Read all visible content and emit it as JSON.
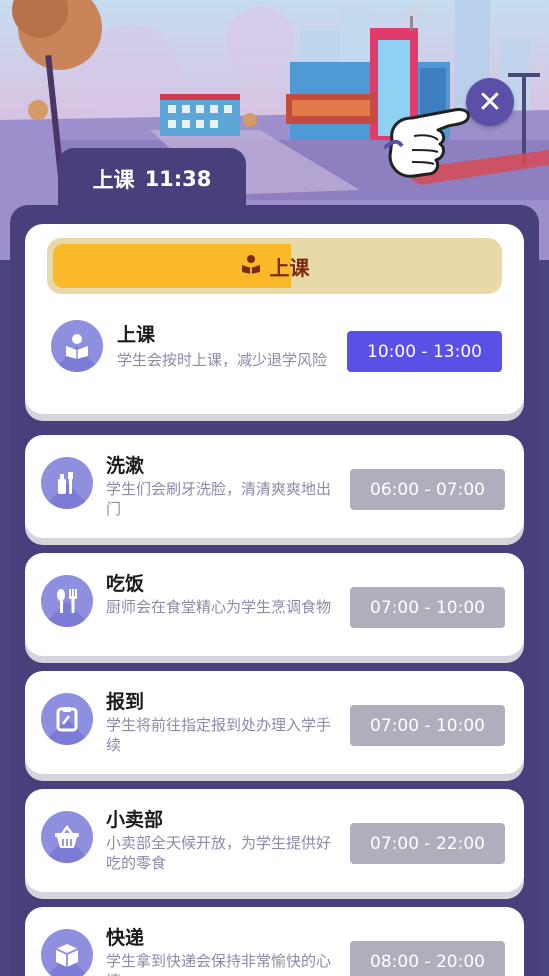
{
  "header": {
    "tab_label": "上课",
    "tab_time": "11:38"
  },
  "close_icon": "close-icon",
  "hand_icon": "pointing-hand-icon",
  "featured": {
    "progress_label": "上课",
    "progress_fraction": 0.53,
    "progress_color": "#fbb829",
    "title": "上课",
    "description": "学生会按时上课，减少退学风险",
    "time": "10:00 - 13:00",
    "icon": "reading-student-icon"
  },
  "activities": [
    {
      "title": "洗漱",
      "description": "学生们会刷牙洗脸，清清爽爽地出门",
      "time": "06:00 - 07:00",
      "icon": "toothbrush-icon"
    },
    {
      "title": "吃饭",
      "description": "厨师会在食堂精心为学生烹调食物",
      "time": "07:00 - 10:00",
      "icon": "utensils-icon"
    },
    {
      "title": "报到",
      "description": "学生将前往指定报到处办理入学手续",
      "time": "07:00 - 10:00",
      "icon": "clipboard-icon"
    },
    {
      "title": "小卖部",
      "description": "小卖部全天候开放，为学生提供好吃的零食",
      "time": "07:00 - 22:00",
      "icon": "basket-icon"
    },
    {
      "title": "快递",
      "description": "学生拿到快递会保持非常愉快的心情",
      "time": "08:00 - 20:00",
      "icon": "package-icon"
    }
  ],
  "colors": {
    "panel": "#48407c",
    "active_time": "#5a4fe6",
    "inactive_time": "#b0aebd",
    "icon_circle": "#8f8fe0"
  }
}
